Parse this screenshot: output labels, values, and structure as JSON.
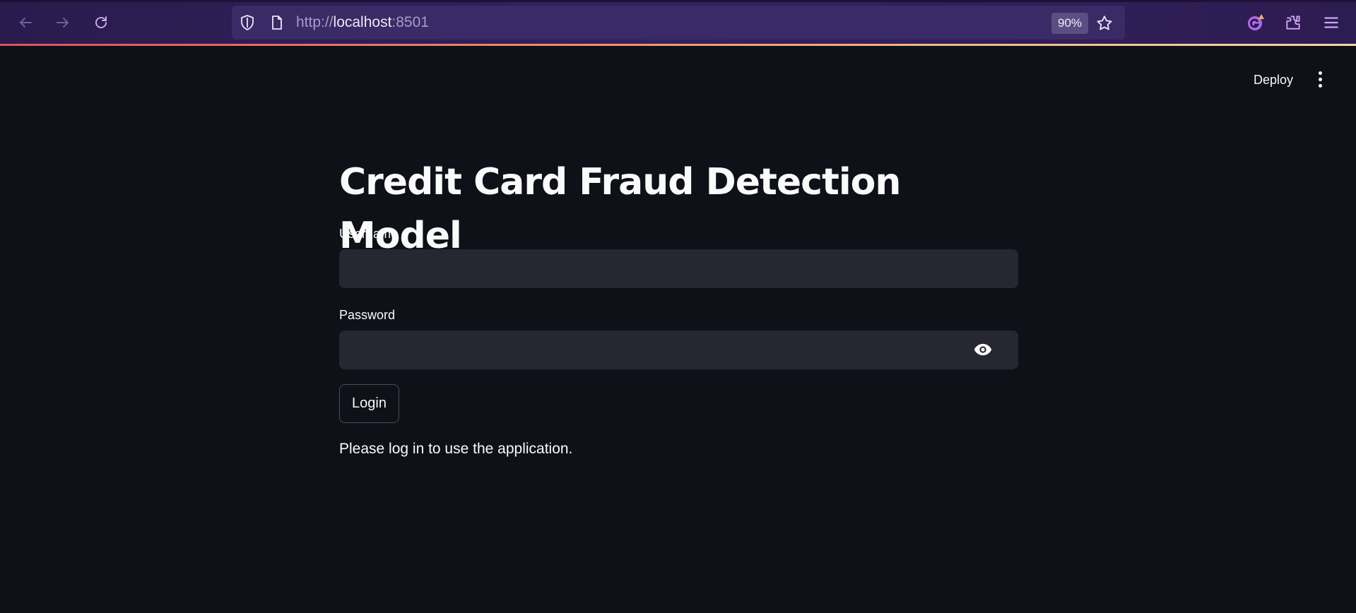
{
  "browser": {
    "url_scheme": "http://",
    "url_host": "localhost",
    "url_port": ":8501",
    "zoom": "90%",
    "icons": [
      "back-arrow-icon",
      "forward-arrow-icon",
      "reload-icon",
      "shield-icon",
      "page-icon",
      "star-icon",
      "profile-icon",
      "extensions-icon",
      "menu-icon"
    ]
  },
  "header": {
    "deploy_label": "Deploy"
  },
  "main": {
    "title": "Credit Card Fraud Detection Model",
    "username_label": "Username",
    "username_value": "",
    "password_label": "Password",
    "password_value": "",
    "login_label": "Login",
    "info_message": "Please log in to use the application."
  },
  "colors": {
    "background": "#0e1117",
    "input_background": "#262730",
    "toolbar": "#2a1b4d",
    "text": "#fafafa"
  }
}
